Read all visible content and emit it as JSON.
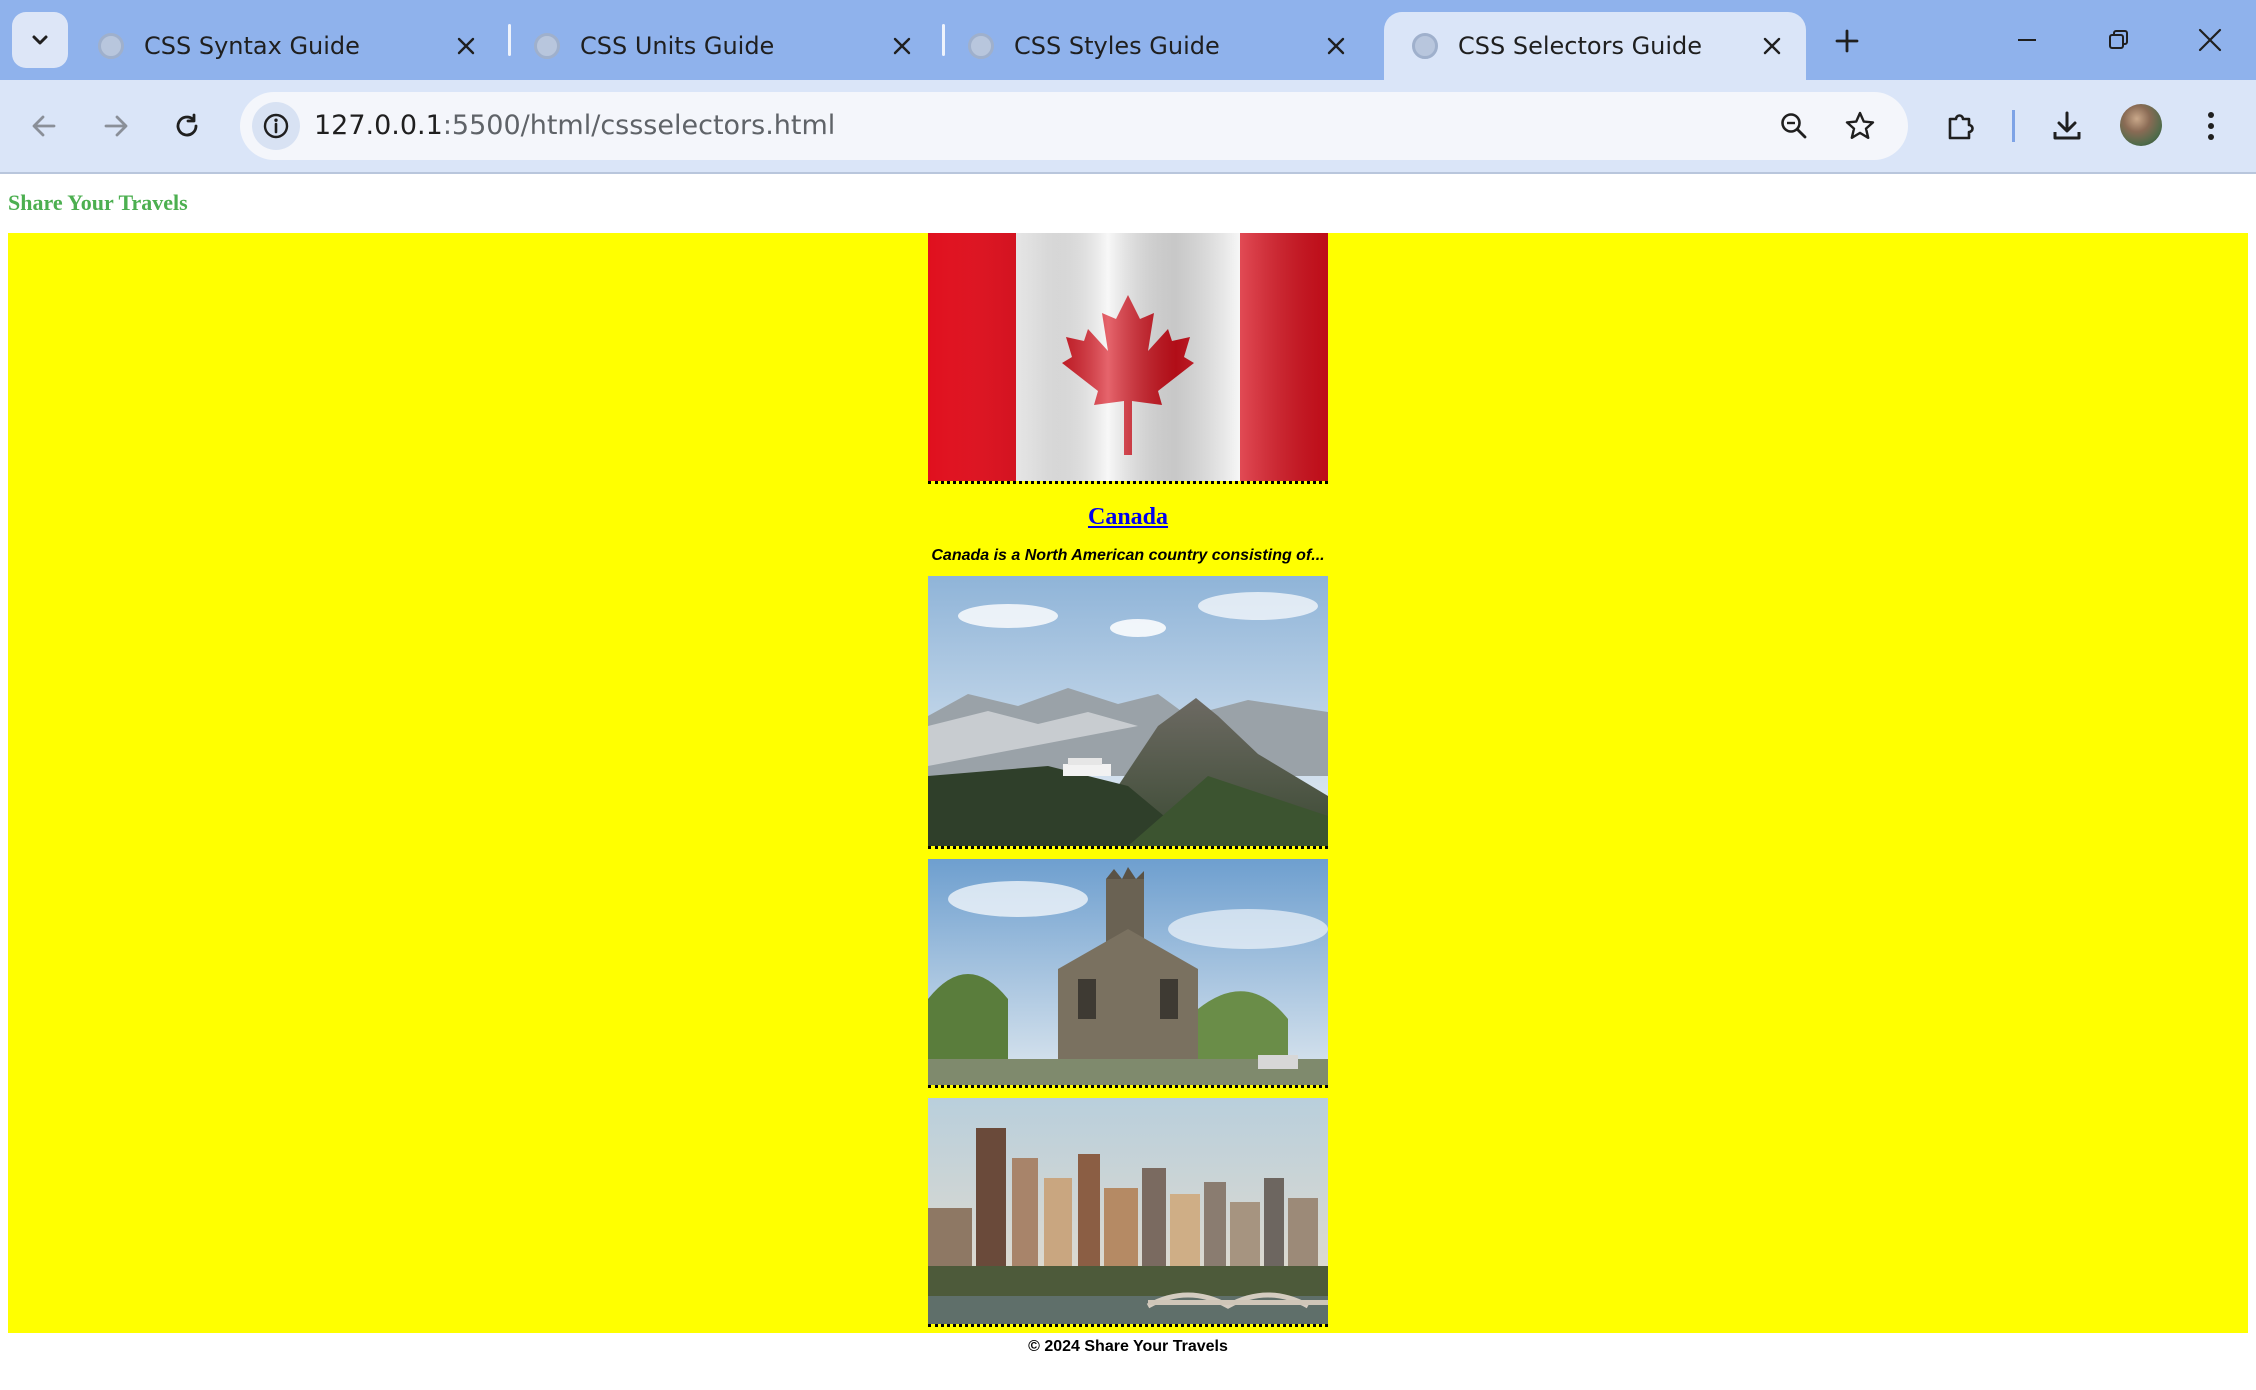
{
  "browser": {
    "tabs": [
      {
        "title": "CSS Syntax Guide",
        "active": false
      },
      {
        "title": "CSS Units Guide",
        "active": false
      },
      {
        "title": "CSS Styles Guide",
        "active": false
      },
      {
        "title": "CSS Selectors Guide",
        "active": true
      }
    ],
    "address": {
      "host": "127.0.0.1",
      "rest": ":5500/html/cssselectors.html"
    },
    "colors": {
      "tab_strip": "#8fb2ec",
      "toolbar": "#dae5f8"
    }
  },
  "page": {
    "site_title": "Share Your Travels",
    "colors": {
      "main_background": "#ffff00",
      "site_title": "#4caf50",
      "link": "#0000ee"
    },
    "article": {
      "country": "Canada",
      "description": "Canada is a North American country consisting of...",
      "images": [
        {
          "subject": "canada-flag"
        },
        {
          "subject": "mountain-landscape"
        },
        {
          "subject": "stone-church"
        },
        {
          "subject": "city-skyline"
        }
      ]
    },
    "footer": "© 2024 Share Your Travels"
  }
}
